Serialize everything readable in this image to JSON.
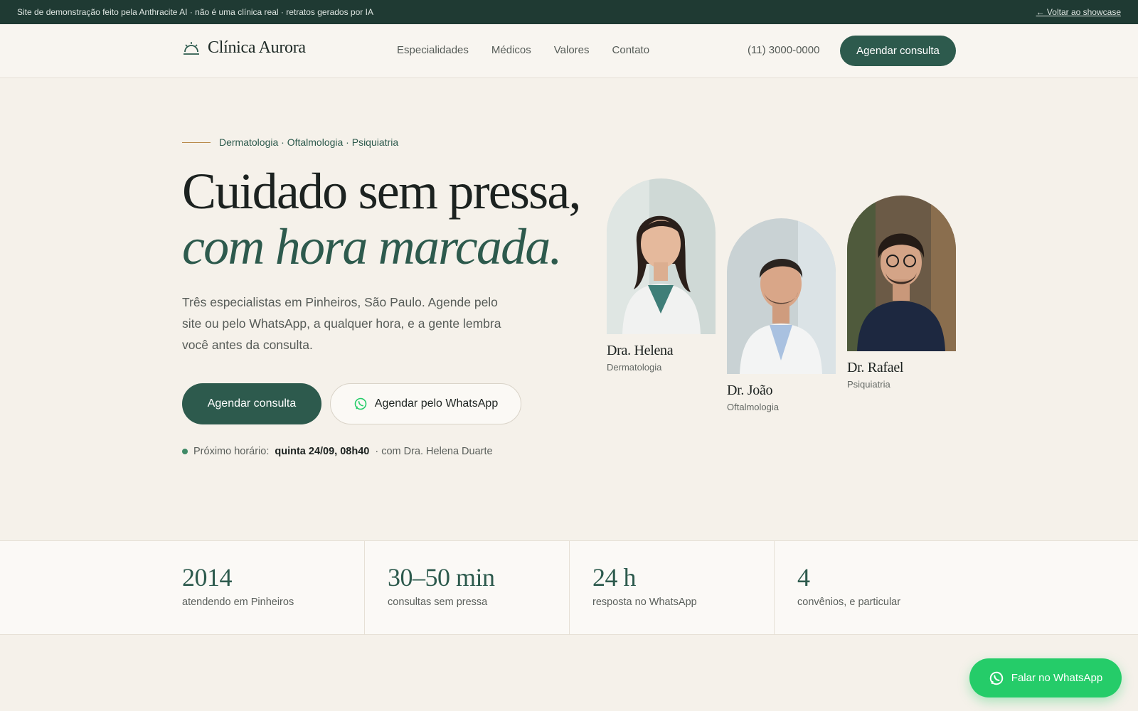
{
  "demo_bar": {
    "note": "Site de demonstração feito pela Anthracite AI · não é uma clínica real · retratos gerados por IA",
    "back_link": "← Voltar ao showcase"
  },
  "header": {
    "logo_text": "Clínica Aurora",
    "nav": [
      "Especialidades",
      "Médicos",
      "Valores",
      "Contato"
    ],
    "phone": "(11) 3000-0000",
    "cta": "Agendar consulta"
  },
  "hero": {
    "eyebrow": "Dermatologia · Oftalmologia · Psiquiatria",
    "title_line1": "Cuidado sem pressa,",
    "title_line2": "com hora marcada.",
    "lead": "Três especialistas em Pinheiros, São Paulo. Agende pelo site ou pelo WhatsApp, a qualquer hora, e a gente lembra você antes da consulta.",
    "btn_primary": "Agendar consulta",
    "btn_whatsapp": "Agendar pelo WhatsApp",
    "next_label": "Próximo horário:",
    "next_time": "quinta 24/09, 08h40",
    "next_with": "· com Dra. Helena Duarte"
  },
  "doctors": [
    {
      "name": "Dra. Helena",
      "specialty": "Dermatologia"
    },
    {
      "name": "Dr. João",
      "specialty": "Oftalmologia"
    },
    {
      "name": "Dr. Rafael",
      "specialty": "Psiquiatria"
    }
  ],
  "stats": [
    {
      "value": "2014",
      "label": "atendendo em Pinheiros"
    },
    {
      "value": "30–50 min",
      "label": "consultas sem pressa"
    },
    {
      "value": "24 h",
      "label": "resposta no WhatsApp"
    },
    {
      "value": "4",
      "label": "convênios, e particular"
    }
  ],
  "fab": {
    "label": "Falar no WhatsApp"
  },
  "colors": {
    "brand": "#2d5a4d",
    "whatsapp": "#25cc69",
    "background": "#f5f1ea",
    "topbar": "#1f3a33"
  }
}
